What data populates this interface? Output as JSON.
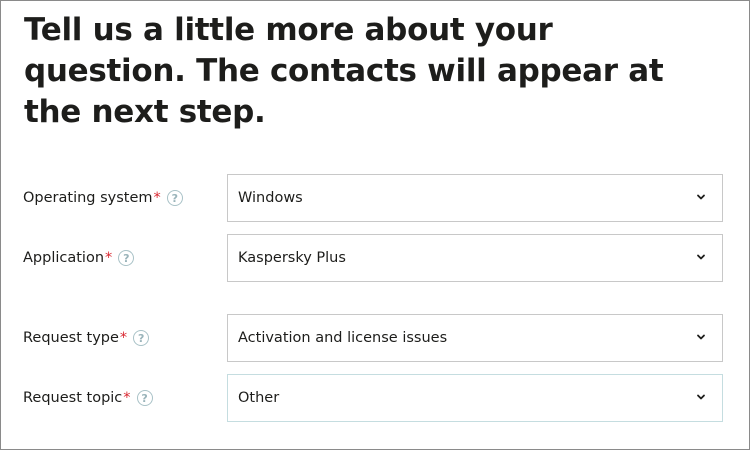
{
  "heading": "Tell us a little more about your question. The contacts will appear at the next step.",
  "required_mark": "*",
  "help_glyph": "?",
  "fields": [
    {
      "label": "Operating system",
      "value": "Windows"
    },
    {
      "label": "Application",
      "value": "Kaspersky Plus"
    },
    {
      "label": "Request type",
      "value": "Activation and license issues"
    },
    {
      "label": "Request topic",
      "value": "Other"
    }
  ],
  "colors": {
    "required": "#d9262f",
    "help_icon": "#9ab4ba",
    "field_border": "#c8c8c8",
    "text": "#1d1d1b"
  }
}
